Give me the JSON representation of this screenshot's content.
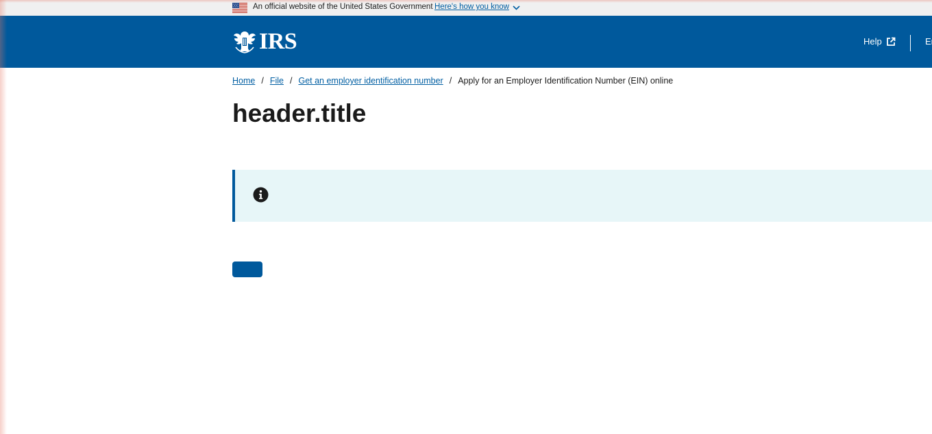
{
  "gov_banner": {
    "official_text": "An official website of the United States Government",
    "how_you_know_link": "Here's how you know"
  },
  "header": {
    "logo_text": "IRS",
    "help_label": "Help",
    "language_label": "Er"
  },
  "breadcrumb": {
    "items": [
      "Home",
      "File",
      "Get an employer identification number"
    ],
    "current": "Apply for an Employer Identification Number (EIN) online"
  },
  "page": {
    "title": "header.title"
  },
  "alert": {
    "text": ""
  },
  "primary_button": {
    "label": ""
  },
  "colors": {
    "header_bg": "#00599c",
    "banner_bg": "#f0f0f0",
    "alert_bg": "#e7f6f8",
    "link": "#005ea2",
    "text": "#1b1b1b"
  },
  "icons": {
    "flag": "us-flag-icon",
    "chevron": "chevron-down-icon",
    "eagle": "irs-eagle-logo",
    "external": "external-link-icon",
    "info": "info-icon"
  }
}
